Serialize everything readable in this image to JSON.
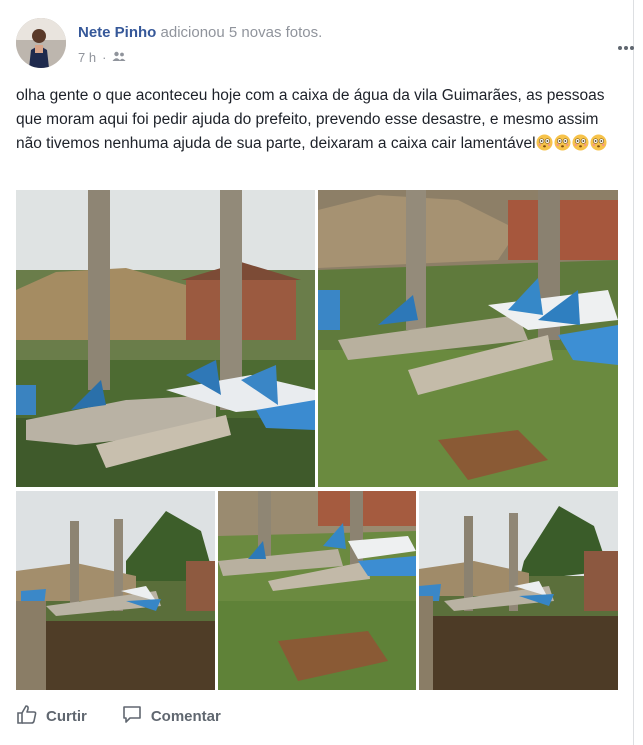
{
  "post": {
    "author": "Nete Pinho",
    "action": "adicionou 5 novas fotos.",
    "time": "7 h",
    "audience_icon": "friends-icon",
    "more_icon": "more-options-icon",
    "text": "olha gente o que aconteceu hoje com a caixa de água da vila Guimarães, as pessoas que moram aqui foi pedir ajuda do prefeito, prevendo esse desastre, e mesmo assim não tivemos nenhuma ajuda de sua parte, deixaram a caixa cair lamentável",
    "emoji_name": "flushed-face-emoji",
    "emoji_count": 4
  },
  "actions": {
    "like": "Curtir",
    "comment": "Comentar"
  },
  "colors": {
    "author": "#365899",
    "muted": "#90949c",
    "action_text": "#606770"
  }
}
